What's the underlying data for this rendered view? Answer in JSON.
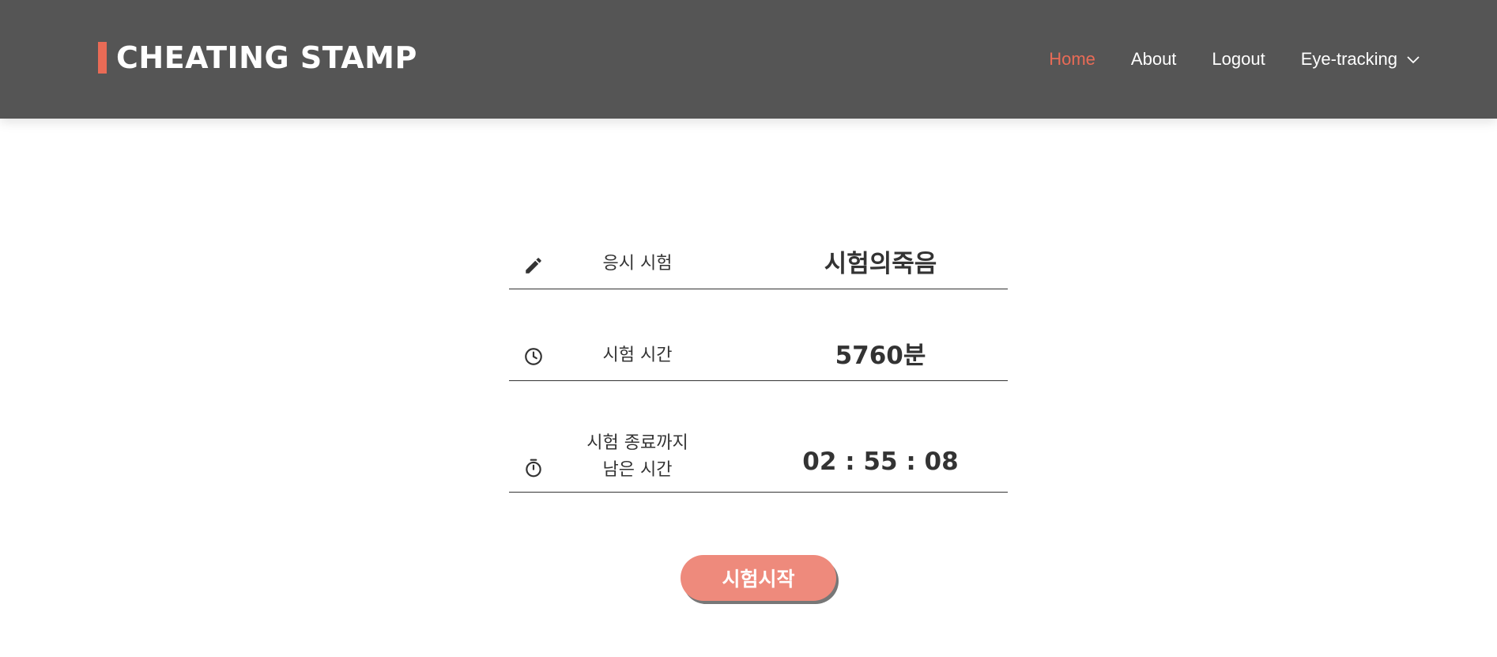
{
  "colors": {
    "accent": "#e96b56",
    "button": "#ee8a7c",
    "header_bg": "#555555",
    "text": "#333333"
  },
  "header": {
    "brand": "CHEATING STAMP",
    "nav": [
      {
        "label": "Home",
        "active": true
      },
      {
        "label": "About",
        "active": false
      },
      {
        "label": "Logout",
        "active": false
      },
      {
        "label": "Eye-tracking",
        "active": false,
        "icon": "chevron-down-icon"
      }
    ]
  },
  "exam": {
    "rows": [
      {
        "icon": "pencil-icon",
        "label": "응시 시험",
        "value": "시험의죽음"
      },
      {
        "icon": "clock-icon",
        "label": "시험 시간",
        "value": "5760분"
      },
      {
        "icon": "stopwatch-icon",
        "label_line1": "시험 종료까지",
        "label_line2": "남은 시간",
        "value": "02 : 55 : 08"
      }
    ],
    "start_button": "시험시작"
  }
}
